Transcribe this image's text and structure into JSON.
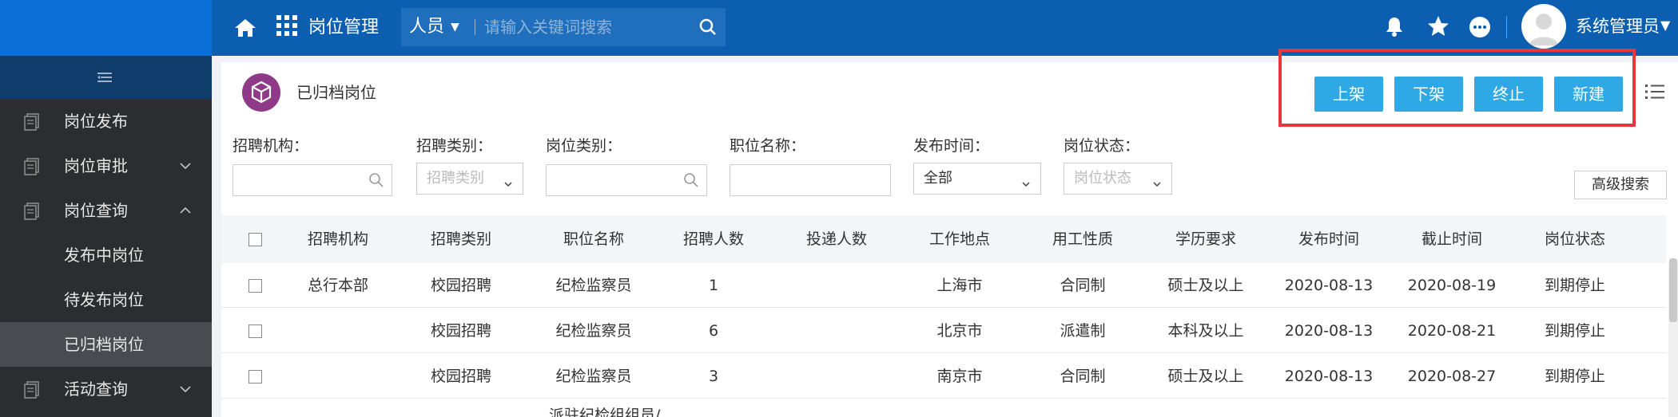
{
  "header": {
    "title": "岗位管理",
    "search_scope": "人员",
    "search_placeholder": "请输入关键词搜索",
    "user_name": "系统管理员"
  },
  "sidebar": {
    "items": [
      {
        "label": "岗位发布"
      },
      {
        "label": "岗位审批"
      },
      {
        "label": "岗位查询"
      },
      {
        "label": "发布中岗位"
      },
      {
        "label": "待发布岗位"
      },
      {
        "label": "已归档岗位"
      },
      {
        "label": "活动查询"
      }
    ]
  },
  "panel": {
    "title": "已归档岗位",
    "buttons": [
      "上架",
      "下架",
      "终止",
      "新建"
    ]
  },
  "filters": {
    "org_label": "招聘机构：",
    "type_label": "招聘类别：",
    "type_placeholder": "招聘类别",
    "category_label": "岗位类别：",
    "name_label": "职位名称：",
    "time_label": "发布时间：",
    "time_value": "全部",
    "status_label": "岗位状态：",
    "status_placeholder": "岗位状态",
    "advanced": "高级搜索"
  },
  "table": {
    "columns": [
      "招聘机构",
      "招聘类别",
      "职位名称",
      "招聘人数",
      "投递人数",
      "工作地点",
      "用工性质",
      "学历要求",
      "发布时间",
      "截止时间",
      "岗位状态"
    ],
    "rows": [
      [
        "总行本部",
        "校园招聘",
        "纪检监察员",
        "1",
        "",
        "上海市",
        "合同制",
        "硕士及以上",
        "2020-08-13",
        "2020-08-19",
        "到期停止"
      ],
      [
        "",
        "校园招聘",
        "纪检监察员",
        "6",
        "",
        "北京市",
        "派遣制",
        "本科及以上",
        "2020-08-13",
        "2020-08-21",
        "到期停止"
      ],
      [
        "",
        "校园招聘",
        "纪检监察员",
        "3",
        "",
        "南京市",
        "合同制",
        "硕士及以上",
        "2020-08-13",
        "2020-08-27",
        "到期停止"
      ]
    ],
    "partial_row_text": "派驻纪检组组员/"
  },
  "colors": {
    "topbar": "#0c5fb0",
    "sidebar": "#2c2d31",
    "button": "#2fa9e6",
    "highlight": "#e8363f",
    "panel_icon": "#8e3a88"
  }
}
